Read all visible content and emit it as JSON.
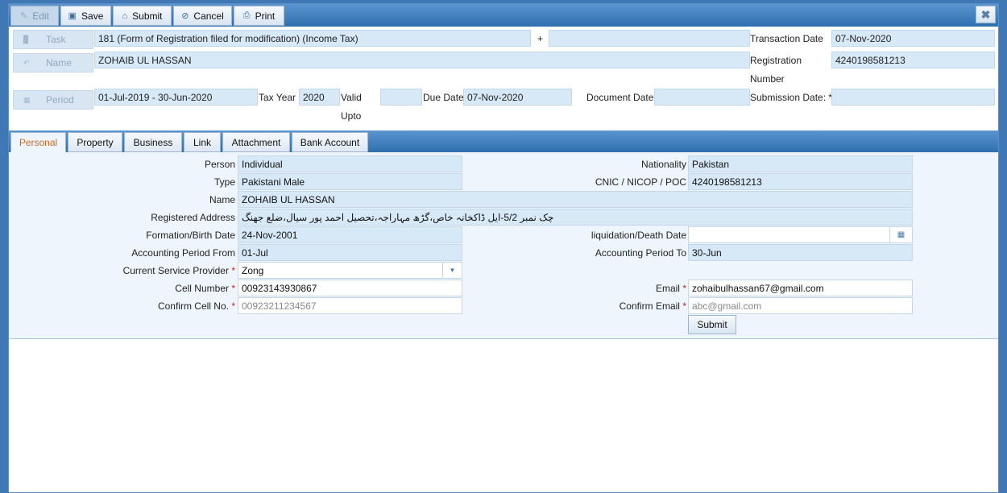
{
  "toolbar": {
    "edit": "Edit",
    "save": "Save",
    "submit": "Submit",
    "cancel": "Cancel",
    "print": "Print",
    "close": "✖"
  },
  "header": {
    "task_label": "Task",
    "task_value": "181 (Form of Registration filed for modification) (Income Tax)",
    "plus": "+",
    "task_extra": "",
    "transaction_date_label": "Transaction Date",
    "transaction_date": "07-Nov-2020",
    "name_label": "Name",
    "name_value": "ZOHAIB UL HASSAN",
    "registration_label_1": "Registration",
    "registration_label_2": "Number",
    "registration_number": "4240198581213",
    "period_label": "Period",
    "period_value": "01-Jul-2019 -  30-Jun-2020",
    "tax_year_label": "Tax Year",
    "tax_year": "2020",
    "valid_label_1": "Valid",
    "valid_label_2": "Upto",
    "valid_upto": "",
    "due_date_label": "Due Date",
    "due_date": "07-Nov-2020",
    "document_date_label": "Document Date",
    "document_date": "",
    "submission_date_label": "Submission Date: *",
    "submission_date": ""
  },
  "tabs": [
    "Personal",
    "Property",
    "Business",
    "Link",
    "Attachment",
    "Bank Account"
  ],
  "personal": {
    "person_label": "Person",
    "person": "Individual",
    "nationality_label": "Nationality",
    "nationality": "Pakistan",
    "type_label": "Type",
    "type": "Pakistani Male",
    "cnic_label": "CNIC / NICOP / POC",
    "cnic": "4240198581213",
    "name_label": "Name",
    "name": "ZOHAIB UL HASSAN",
    "address_label": "Registered Address",
    "address": "چک نمبر 5/2-ایل ڈاکخانہ خاص،گڑھ مہاراجہ،تحصیل احمد پور سیال،ضلع جھنگ",
    "birth_label": "Formation/Birth Date",
    "birth": "24-Nov-2001",
    "death_label": "liquidation/Death Date",
    "death": "",
    "acc_from_label": "Accounting Period From",
    "acc_from": "01-Jul",
    "acc_to_label": "Accounting Period To",
    "acc_to": "30-Jun",
    "provider_label": "Current Service Provider",
    "provider": "Zong",
    "cell_label": "Cell Number",
    "cell": "00923143930867",
    "email_label": "Email",
    "email": "zohaibulhassan67@gmail.com",
    "confirm_cell_label": "Confirm Cell No.",
    "confirm_cell_placeholder": "00923211234567",
    "confirm_email_label": "Confirm Email",
    "confirm_email_placeholder": "abc@gmail.com",
    "required_mark": "*",
    "submit": "Submit"
  }
}
